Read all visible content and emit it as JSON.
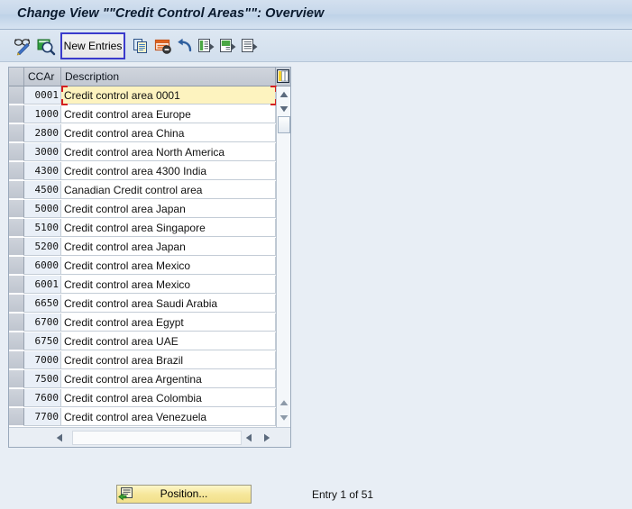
{
  "window": {
    "title": "Change View \"\"Credit Control Areas\"\": Overview"
  },
  "toolbar": {
    "icons": [
      {
        "name": "display-change-icon",
        "title": "Display/Change"
      },
      {
        "name": "details-magnifier-icon",
        "title": "Details"
      },
      {
        "name": "copy-as-icon",
        "title": "Copy As..."
      },
      {
        "name": "delete-icon",
        "title": "Delete"
      },
      {
        "name": "undo-icon",
        "title": "Undo Change"
      },
      {
        "name": "select-all-icon",
        "title": "Select All"
      },
      {
        "name": "select-block-icon",
        "title": "Select Block"
      },
      {
        "name": "deselect-all-icon",
        "title": "Deselect All"
      }
    ],
    "new_entries_label": "New Entries"
  },
  "table": {
    "columns": [
      {
        "key": "ccar",
        "label": "CCAr"
      },
      {
        "key": "description",
        "label": "Description"
      }
    ],
    "selected_row_index": 0,
    "rows": [
      {
        "ccar": "0001",
        "description": "Credit control area 0001"
      },
      {
        "ccar": "1000",
        "description": "Credit control area Europe"
      },
      {
        "ccar": "2800",
        "description": "Credit control area China"
      },
      {
        "ccar": "3000",
        "description": "Credit control area North America"
      },
      {
        "ccar": "4300",
        "description": "Credit control area 4300 India"
      },
      {
        "ccar": "4500",
        "description": "Canadian Credit control area"
      },
      {
        "ccar": "5000",
        "description": "Credit control area Japan"
      },
      {
        "ccar": "5100",
        "description": "Credit control area Singapore"
      },
      {
        "ccar": "5200",
        "description": "Credit control area Japan"
      },
      {
        "ccar": "6000",
        "description": "Credit control area Mexico"
      },
      {
        "ccar": "6001",
        "description": "Credit control area Mexico"
      },
      {
        "ccar": "6650",
        "description": "Credit control area Saudi Arabia"
      },
      {
        "ccar": "6700",
        "description": "Credit control area Egypt"
      },
      {
        "ccar": "6750",
        "description": "Credit control area UAE"
      },
      {
        "ccar": "7000",
        "description": "Credit control area Brazil"
      },
      {
        "ccar": "7500",
        "description": "Credit control area Argentina"
      },
      {
        "ccar": "7600",
        "description": "Credit control area Colombia"
      },
      {
        "ccar": "7700",
        "description": "Credit control area Venezuela"
      }
    ]
  },
  "footer": {
    "position_label": "Position...",
    "entry_count_text": "Entry 1 of 51"
  },
  "colors": {
    "page_background": "#e8eef5",
    "title_bar": "#c6d7ea",
    "selected_row": "#fdf3bf",
    "focus_marker": "#d42020",
    "new_entries_border": "#3b3bcc",
    "position_button": "#f6e79a",
    "key_column": "#e9eff7"
  }
}
